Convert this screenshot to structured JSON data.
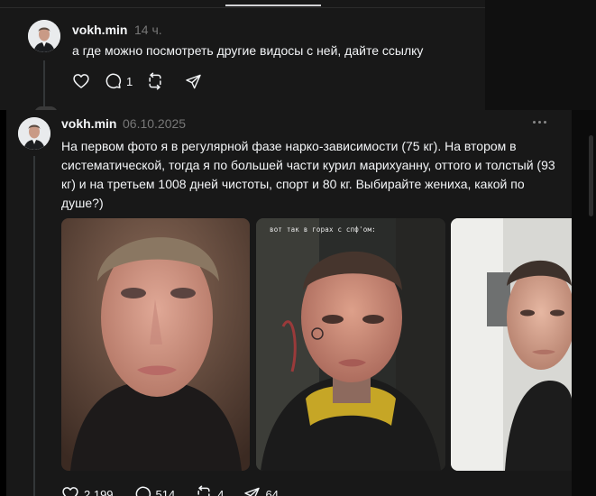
{
  "background_post": {
    "username": "vokh.min",
    "timestamp": "14 ч.",
    "text": "а где можно посмотреть другие видосы с ней, дайте ссылку",
    "replies": "1",
    "icons": [
      "heart-icon",
      "comment-icon",
      "repost-icon",
      "share-icon"
    ]
  },
  "post": {
    "username": "vokh.min",
    "timestamp": "06.10.2025",
    "text": "На первом фото я в регулярной фазе нарко-зависимости (75 кг). На втором в систематической, тогда я по большей части курил марихуанну, оттого и толстый (93 кг) и на третьем 1008 дней чистоты, спорт и 80 кг. Выбирайте жениха, какой по душе?)",
    "photo_caption": "вот так в горах с спф'ом:",
    "photos": [
      "photo-1",
      "photo-2",
      "photo-3"
    ],
    "likes": "2 199",
    "replies": "514",
    "reposts": "4",
    "shares": "64",
    "icons": [
      "heart-icon",
      "comment-icon",
      "repost-icon",
      "share-icon",
      "more-icon"
    ]
  },
  "colors": {
    "background": "#000000",
    "card": "#181818",
    "text": "#f3f5f7",
    "muted": "#777777"
  }
}
